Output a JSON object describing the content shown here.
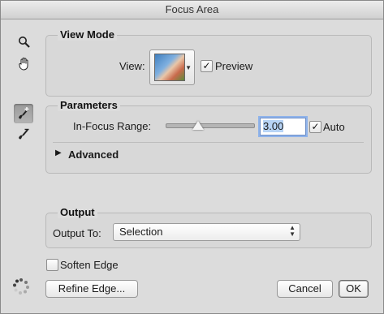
{
  "window": {
    "title": "Focus Area"
  },
  "tools": [
    {
      "name": "zoom-tool",
      "icon": "magnifier-icon"
    },
    {
      "name": "hand-tool",
      "icon": "hand-icon"
    },
    {
      "name": "focus-area-add-tool",
      "icon": "brush-plus-icon",
      "selected": true
    },
    {
      "name": "focus-area-subtract-tool",
      "icon": "brush-minus-icon"
    }
  ],
  "view_mode": {
    "heading": "View Mode",
    "view_label": "View:",
    "preview_label": "Preview",
    "preview_checked": true
  },
  "parameters": {
    "heading": "Parameters",
    "range_label": "In-Focus Range:",
    "range_value": "3.00",
    "range_fraction": 0.37,
    "auto_label": "Auto",
    "auto_checked": true,
    "advanced_label": "Advanced"
  },
  "output": {
    "heading": "Output",
    "output_to_label": "Output To:",
    "output_to_value": "Selection"
  },
  "soften_edge": {
    "label": "Soften Edge",
    "checked": false
  },
  "buttons": {
    "refine_edge": "Refine Edge...",
    "cancel": "Cancel",
    "ok": "OK"
  }
}
